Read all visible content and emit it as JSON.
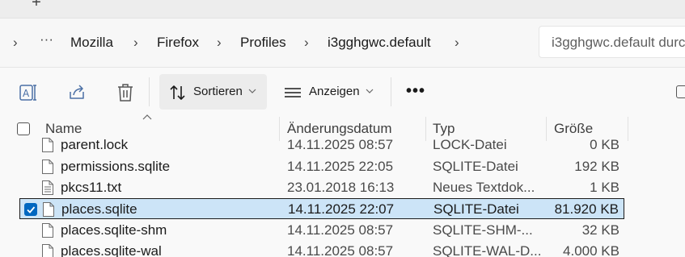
{
  "tabbar": {
    "new_tab_label": "+"
  },
  "breadcrumb": {
    "items": [
      "Mozilla",
      "Firefox",
      "Profiles",
      "i3gghgwc.default"
    ]
  },
  "search": {
    "placeholder": "i3gghgwc.default durc"
  },
  "toolbar": {
    "sort_label": "Sortieren",
    "view_label": "Anzeigen",
    "more_label": "•••"
  },
  "columns": {
    "name": "Name",
    "date": "Änderungsdatum",
    "type": "Typ",
    "size": "Größe"
  },
  "files": [
    {
      "name": "parent.lock",
      "date": "14.11.2025 08:57",
      "type": "LOCK-Datei",
      "size": "0 KB",
      "selected": false
    },
    {
      "name": "permissions.sqlite",
      "date": "14.11.2025 22:05",
      "type": "SQLITE-Datei",
      "size": "192 KB",
      "selected": false
    },
    {
      "name": "pkcs11.txt",
      "date": "23.01.2018 16:13",
      "type": "Neues Textdok...",
      "size": "1 KB",
      "selected": false
    },
    {
      "name": "places.sqlite",
      "date": "14.11.2025 22:07",
      "type": "SQLITE-Datei",
      "size": "81.920 KB",
      "selected": true
    },
    {
      "name": "places.sqlite-shm",
      "date": "14.11.2025 08:57",
      "type": "SQLITE-SHM-...",
      "size": "32 KB",
      "selected": false
    },
    {
      "name": "places.sqlite-wal",
      "date": "14.11.2025 08:57",
      "type": "SQLITE-WAL-D...",
      "size": "4.000 KB",
      "selected": false
    }
  ],
  "colors": {
    "selection_bg": "#cce4f7",
    "accent": "#0067c0"
  }
}
